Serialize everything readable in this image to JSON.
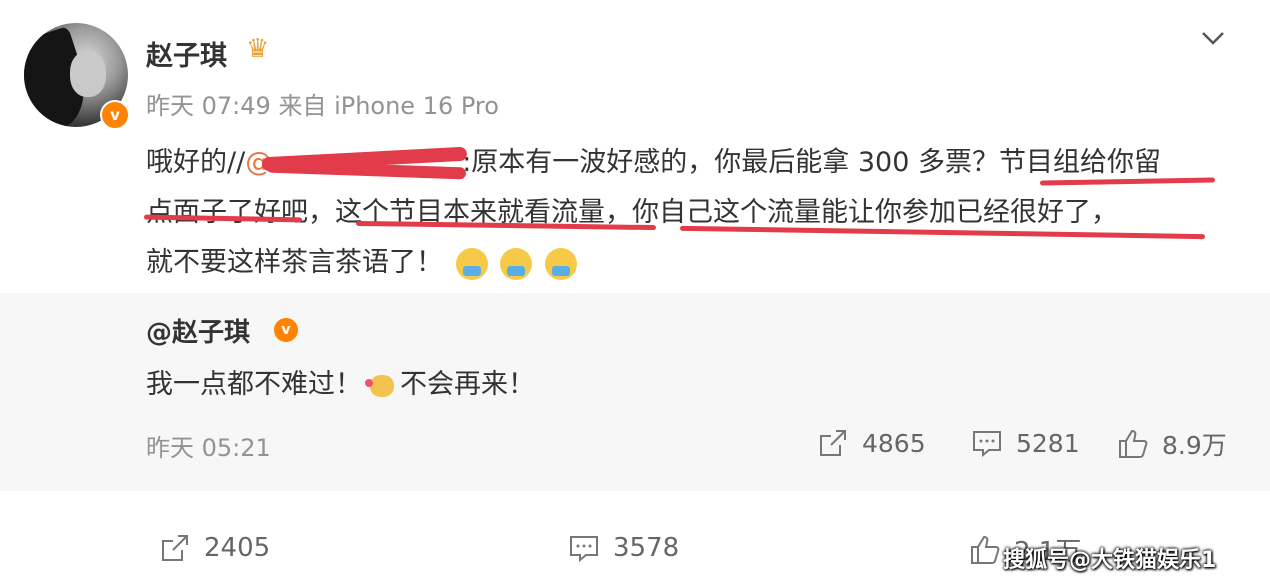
{
  "user": {
    "name": "赵子琪",
    "time": "昨天 07:49",
    "source": "来自 iPhone 16 Pro",
    "verified": "v"
  },
  "post": {
    "prefix": "哦好的//",
    "mention": "@",
    "part1": ":原本有一波好感的，你最后能拿 300 多票？",
    "part2": "节目组给你留",
    "line2a": "点面子了好",
    "line2b": "吧，",
    "line2c": "这个节目本来就看流量",
    "line2d": "，",
    "line2e": "你自己这个流量能让你参加已经很好了",
    "line2f": "，",
    "line3": "就不要这样茶言茶语了！"
  },
  "quoted": {
    "name": "@赵子琪",
    "verified": "v",
    "text_a": "我一点都不难过！",
    "text_b": "不会再来！",
    "time": "昨天 05:21",
    "reposts": "4865",
    "comments": "5281",
    "likes": "8.9万"
  },
  "footer": {
    "reposts": "2405",
    "comments": "3578",
    "likes": "2.1万"
  },
  "watermark": "搜狐号@大铁猫娱乐1",
  "colors": {
    "accent": "#ff8200",
    "mention": "#eb7340",
    "underline": "#e23b4a"
  }
}
